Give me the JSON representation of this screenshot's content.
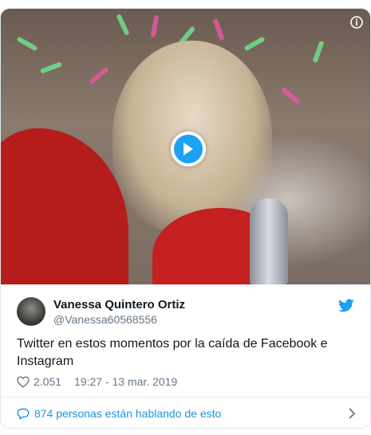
{
  "tweet": {
    "author_name": "Vanessa Quintero Ortiz",
    "handle": "@Vanessa60568556",
    "text": "Twitter en estos momentos por la caída de Facebook e Instagram",
    "likes": "2.051",
    "timestamp": "19:27 - 13 mar. 2019"
  },
  "conversation": {
    "label": "874 personas están hablando de esto"
  },
  "icons": {
    "play": "play-icon",
    "info": "info-icon",
    "brand": "twitter-bird-icon",
    "like": "heart-icon",
    "reply": "speech-bubble-icon",
    "more": "chevron-right-icon"
  },
  "colors": {
    "accent": "#1da1f2",
    "link": "#1b95e0",
    "text": "#14171a",
    "muted": "#657786",
    "border": "#e1e8ed"
  }
}
